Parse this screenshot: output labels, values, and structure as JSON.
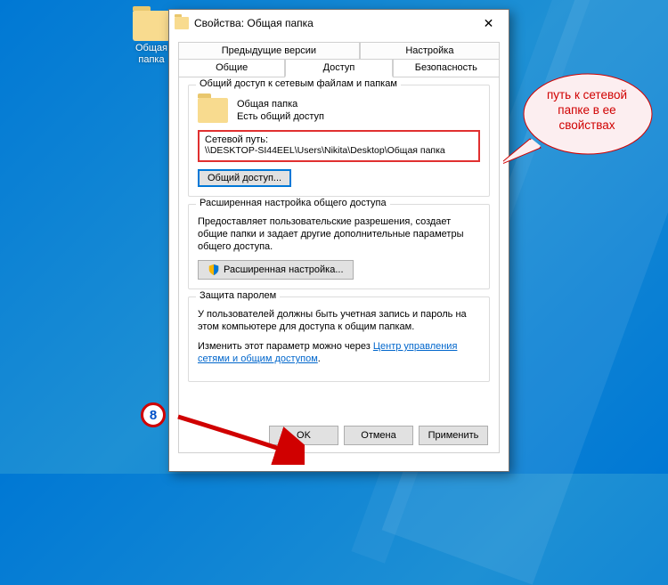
{
  "desktop_icon": {
    "label": "Общая папка"
  },
  "dialog": {
    "title": "Свойства: Общая папка",
    "tabs_row1": [
      "Предыдущие версии",
      "Настройка"
    ],
    "tabs_row2": [
      "Общие",
      "Доступ",
      "Безопасность"
    ],
    "active_tab": "Доступ"
  },
  "share_group": {
    "label": "Общий доступ к сетевым файлам и папкам",
    "folder_name": "Общая папка",
    "status": "Есть общий доступ",
    "path_label": "Сетевой путь:",
    "path_value": "\\\\DESKTOP-SI44EEL\\Users\\Nikita\\Desktop\\Общая папка",
    "share_button": "Общий доступ..."
  },
  "adv_group": {
    "label": "Расширенная настройка общего доступа",
    "desc": "Предоставляет пользовательские разрешения, создает общие папки и задает другие дополнительные параметры общего доступа.",
    "button": "Расширенная настройка..."
  },
  "pwd_group": {
    "label": "Защита паролем",
    "desc1": "У пользователей должны быть учетная запись и пароль на этом компьютере для доступа к общим папкам.",
    "desc2_pre": "Изменить этот параметр можно через ",
    "desc2_link": "Центр управления сетями и общим доступом",
    "desc2_post": "."
  },
  "footer": {
    "ok": "OK",
    "cancel": "Отмена",
    "apply": "Применить"
  },
  "callout": {
    "text": "путь к сетевой папке в ее свойствах"
  },
  "step": {
    "number": "8"
  }
}
